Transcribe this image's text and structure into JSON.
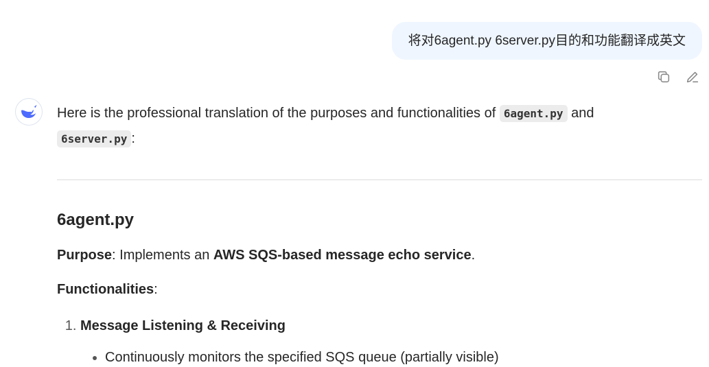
{
  "user_message": {
    "text": "将对6agent.py 6server.py目的和功能翻译成英文"
  },
  "actions": {
    "copy_icon": "copy-icon",
    "edit_icon": "edit-icon"
  },
  "assistant": {
    "avatar_icon": "whale-logo-icon",
    "intro_text": "Here is the professional translation of the purposes and functionalities of",
    "code1": "6agent.py",
    "intro_and": "and",
    "code2": "6server.py",
    "intro_colon": ":",
    "section_title": "6agent.py",
    "purpose_label": "Purpose",
    "purpose_mid": ": Implements an ",
    "purpose_bold": "AWS SQS-based message echo service",
    "purpose_end": ".",
    "functionalities_label": "Functionalities",
    "functionalities_colon": ":",
    "item1_title": "Message Listening & Receiving",
    "item1_sub1": "Continuously monitors the specified SQS queue (partially visible)"
  },
  "colors": {
    "bubble_bg": "#eff6ff",
    "brand_blue": "#4d6bfe",
    "text": "#262626",
    "code_bg": "#ececec"
  }
}
